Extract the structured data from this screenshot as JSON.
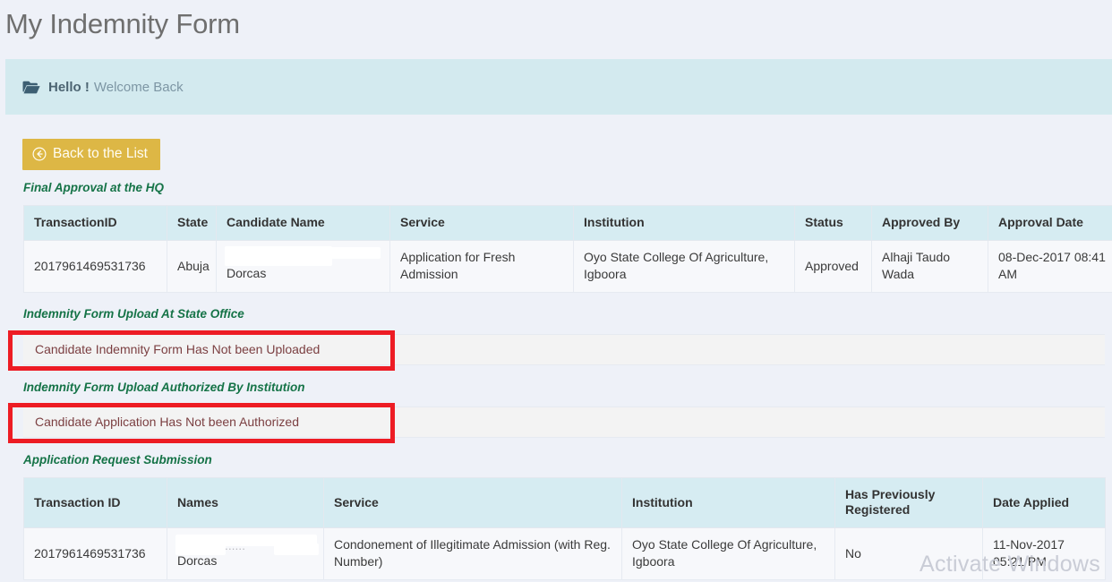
{
  "page": {
    "title": "My Indemnity Form"
  },
  "banner": {
    "icon": "open-folder-icon",
    "hello": "Hello !",
    "message": "Welcome Back"
  },
  "toolbar": {
    "back_button_label": "Back to the List",
    "back_button_icon": "circle-arrow-left-icon",
    "back_button_color": "#ddb745"
  },
  "sections": {
    "final_approval": {
      "heading": "Final Approval at the HQ",
      "columns": [
        "TransactionID",
        "State",
        "Candidate Name",
        "Service",
        "Institution",
        "Status",
        "Approved By",
        "Approval Date"
      ],
      "rows": [
        {
          "transaction_id": "2017961469531736",
          "state": "Abuja",
          "candidate_name_redacted_ghost": "...rap...m...",
          "candidate_name": "Dorcas",
          "service": "Application for Fresh Admission",
          "institution": "Oyo State College Of Agriculture, Igboora",
          "status": "Approved",
          "approved_by": "Alhaji Taudo Wada",
          "approval_date": "08-Dec-2017 08:41 AM"
        }
      ]
    },
    "state_office_upload": {
      "heading": "Indemnity Form Upload At State Office",
      "alert": "Candidate Indemnity Form Has Not been Uploaded"
    },
    "institution_authorization": {
      "heading": "Indemnity Form Upload Authorized By Institution",
      "alert": "Candidate Application Has Not been Authorized"
    },
    "application_request": {
      "heading": "Application Request Submission",
      "columns": [
        "Transaction ID",
        "Names",
        "Service",
        "Institution",
        "Has Previously Registered",
        "Date Applied"
      ],
      "rows": [
        {
          "transaction_id": "2017961469531736",
          "names_redacted_ghost": "..... ......p......",
          "names": "Dorcas",
          "service": "Condonement of Illegitimate Admission (with Reg. Number)",
          "institution": "Oyo State College Of Agriculture, Igboora",
          "has_previously_registered": "No",
          "date_applied_line1": "11-Nov-2017",
          "date_applied_line2": "05:21 PM"
        }
      ]
    }
  },
  "annotations": {
    "highlight_color": "#ed1c24"
  },
  "watermark": {
    "text": "Activate Windows"
  }
}
